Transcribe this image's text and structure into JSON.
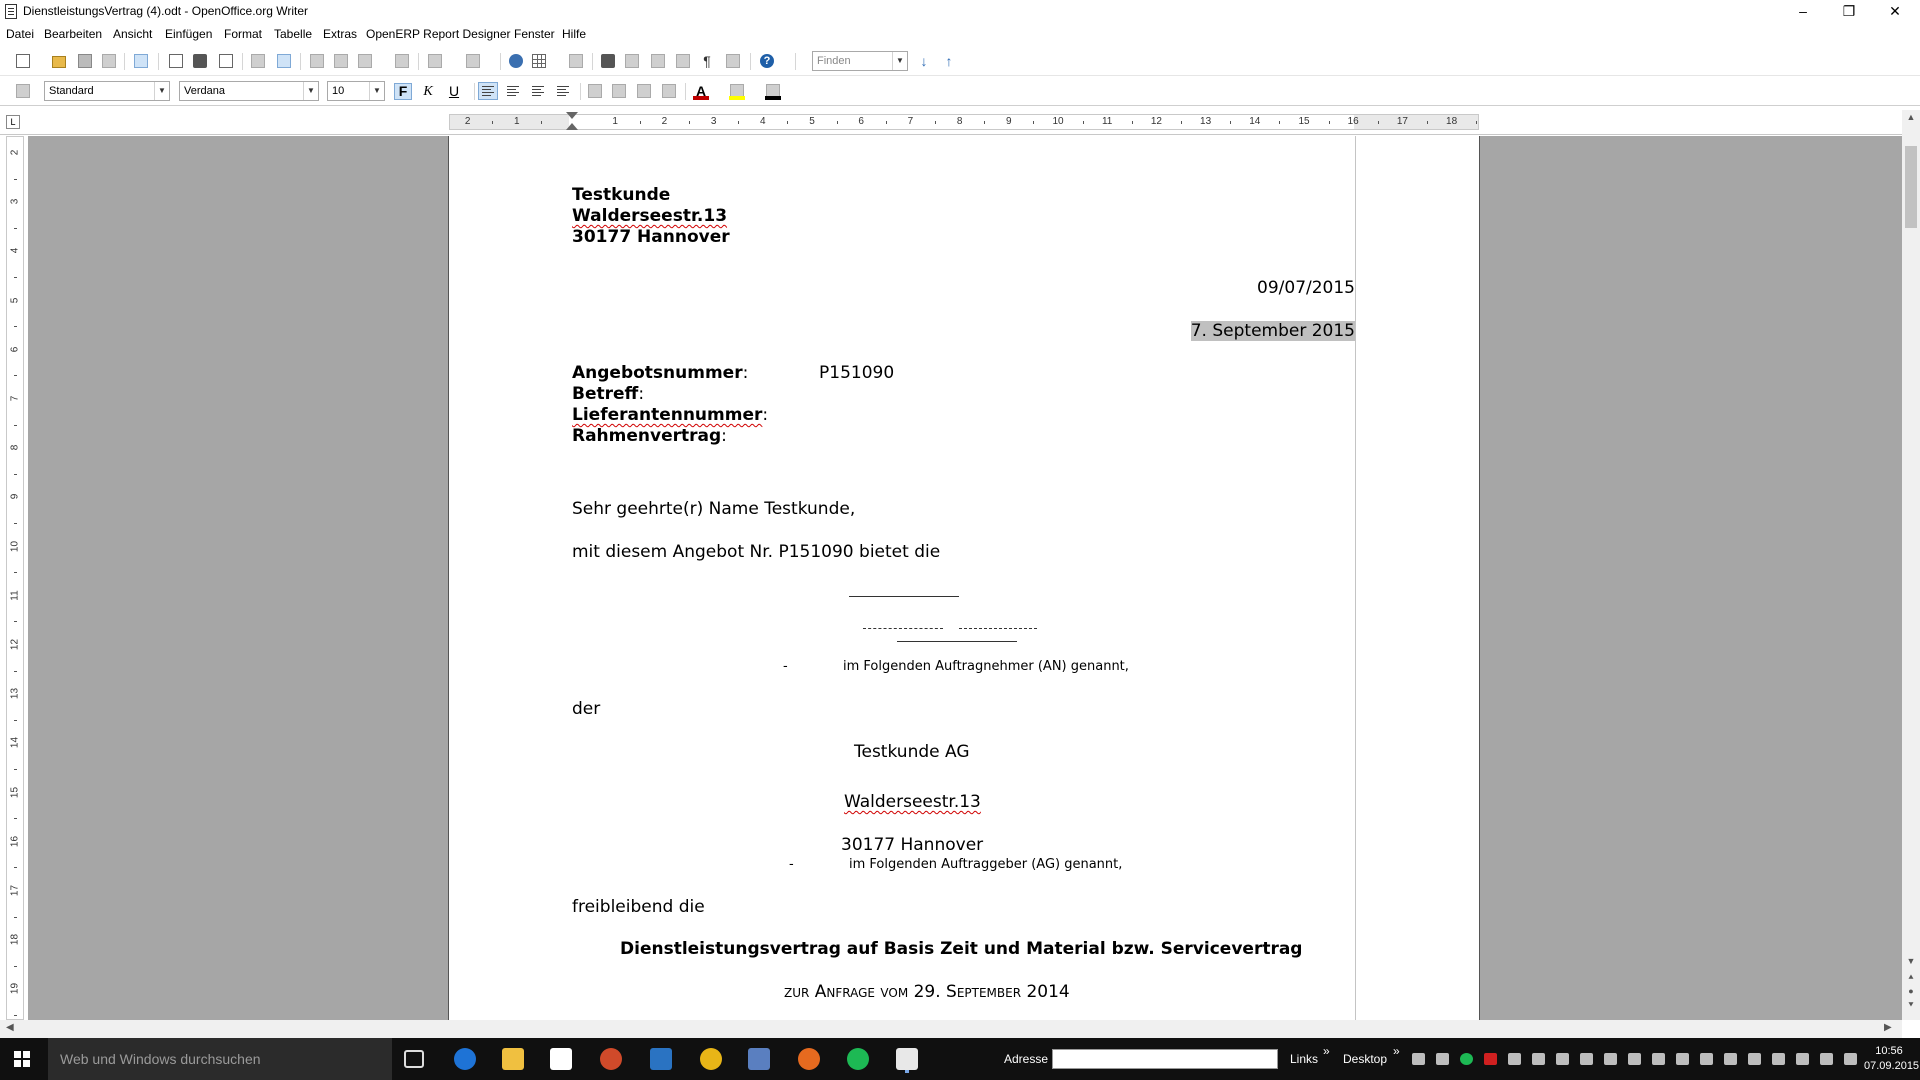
{
  "window": {
    "title": "DienstleistungsVertrag (4).odt - OpenOffice.org Writer",
    "minimize": "–",
    "restore": "❐",
    "close": "✕"
  },
  "menu": [
    "Datei",
    "Bearbeiten",
    "Ansicht",
    "Einfügen",
    "Format",
    "Tabelle",
    "Extras",
    "OpenERP Report Designer",
    "Fenster",
    "Hilfe"
  ],
  "toolbar": {
    "find_placeholder": "Finden",
    "paragraph_style": "Standard",
    "font_name": "Verdana",
    "font_size": "10",
    "bold_label": "F",
    "italic_label": "K",
    "underline_label": "U",
    "font_color": "#c00000",
    "highlight_color": "#ffff00",
    "bg_color": "#000000",
    "help_label": "?",
    "pilcrow": "¶"
  },
  "ruler": {
    "corner": "L",
    "h_labels": [
      "2",
      "1",
      "1",
      "2",
      "3",
      "4",
      "5",
      "6",
      "7",
      "8",
      "9",
      "10",
      "11",
      "12",
      "13",
      "14",
      "15",
      "16",
      "17",
      "18"
    ],
    "v_labels": [
      "2",
      "3",
      "4",
      "5",
      "6",
      "7",
      "8",
      "9",
      "10",
      "11",
      "12",
      "13",
      "14",
      "15",
      "16",
      "17",
      "18",
      "19"
    ]
  },
  "document": {
    "customer_name": "Testkunde",
    "customer_street": "Walderseestr.13",
    "customer_city": "30177 Hannover",
    "date_numeric": "09/07/2015",
    "date_long": "7. September 2015",
    "offer_label": "Angebotsnummer",
    "offer_value": "P151090",
    "subject_label": "Betreff",
    "supplier_label": "Lieferantennummer",
    "framework_label": "Rahmenvertrag",
    "colon": ":",
    "salutation": "Sehr geehrte(r) Name   Testkunde,",
    "intro": "mit diesem Angebot Nr.  P151090 bietet die",
    "an_line": "im Folgenden Auftragnehmer (AN) genannt,",
    "dash": "-",
    "der": "der",
    "ag_company": "Testkunde AG",
    "ag_street": "Walderseestr.13",
    "ag_city": "30177 Hannover",
    "ag_line": "im Folgenden Auftraggeber (AG) genannt,",
    "freibleibend": "freibleibend die",
    "contract_title": "Dienstleistungsvertrag auf Basis Zeit und Material bzw. Servicevertrag",
    "request_line": "zur Anfrage vom 29. September 2014"
  },
  "taskbar": {
    "search_placeholder": "Web und Windows durchsuchen",
    "address_label": "Adresse",
    "links_label": "Links",
    "desktop_label": "Desktop",
    "chevron": "»",
    "time": "10:56",
    "date": "07.09.2015"
  }
}
